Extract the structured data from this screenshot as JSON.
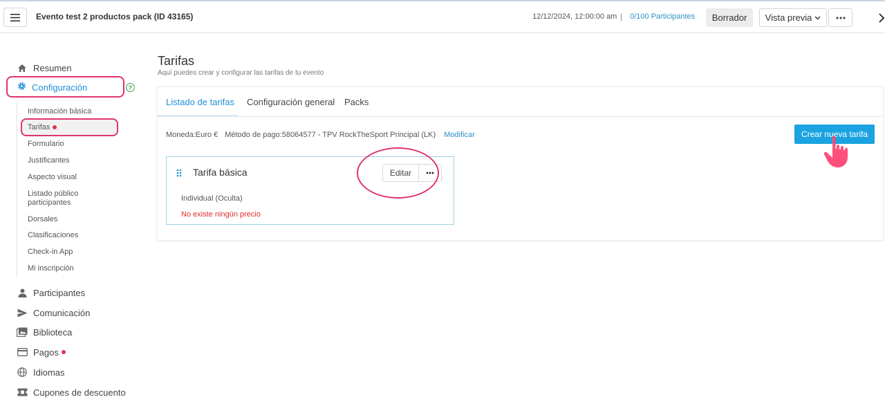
{
  "header": {
    "event_title": "Evento test 2 productos pack (ID 43165)",
    "date": "12/12/2024, 12:00:00 am",
    "separator": "|",
    "participants": "0/100 Participantes",
    "draft_label": "Borrador",
    "preview_label": "Vista previa"
  },
  "sidebar": {
    "resumen": "Resumen",
    "configuracion": "Configuración",
    "help": "?",
    "sub_items": [
      "Información básica",
      "Tarifas",
      "Formulario",
      "Justificantes",
      "Aspecto visual",
      "Listado público participantes",
      "Dorsales",
      "Clasificaciones",
      "Check-in App",
      "Mi inscripción"
    ],
    "participantes": "Participantes",
    "comunicacion": "Comunicación",
    "biblioteca": "Biblioteca",
    "pagos": "Pagos",
    "idiomas": "Idiomas",
    "cupones": "Cupones de descuento"
  },
  "main": {
    "title": "Tarifas",
    "subtitle": "Aquí puedes crear y configurar las tarifas de tu evento",
    "tabs": [
      "Listado de tarifas",
      "Configuración general",
      "Packs"
    ],
    "currency": "Moneda:Euro €",
    "payment_method": "Método de pago:58064577 - TPV RockTheSport Principal (LK)",
    "modify_label": "Modificar",
    "create_button": "Crear nueva tarifa",
    "tarifa": {
      "name": "Tarifa básica",
      "edit_label": "Editar",
      "type": "Individual (Oculta)",
      "no_price": "No existe ningún precio"
    }
  },
  "colors": {
    "accent": "#1e8fd6",
    "primary_button": "#1aa3e0",
    "highlight": "#e0336a",
    "error": "#e02b2b"
  }
}
